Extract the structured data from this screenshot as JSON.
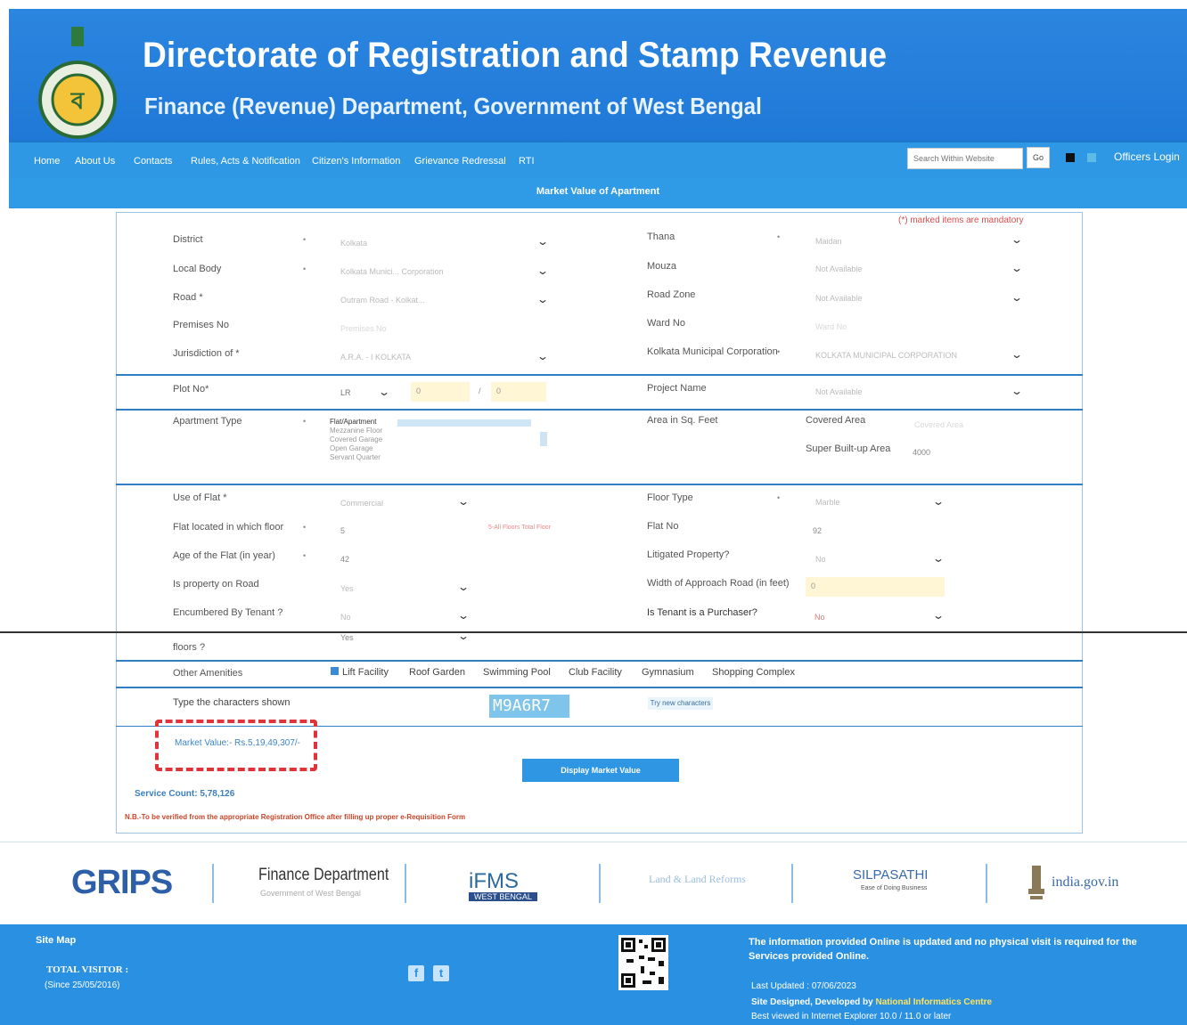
{
  "header": {
    "title": "Directorate of Registration and Stamp Revenue",
    "subtitle": "Finance (Revenue) Department, Government of West Bengal"
  },
  "nav": {
    "items": [
      "Home",
      "About Us",
      "Contacts",
      "Rules, Acts & Notification",
      "Citizen's Information",
      "Grievance Redressal",
      "RTI"
    ],
    "search_placeholder": "Search Within Website",
    "go_label": "Go",
    "officers_login": "Officers Login"
  },
  "section_title": "Market Value of Apartment",
  "mandatory_note": "(*) marked items are mandatory",
  "fields": {
    "district": {
      "label": "District",
      "value": "Kolkata"
    },
    "local_body": {
      "label": "Local Body",
      "value": "Kolkata Munici... Corporation"
    },
    "road": {
      "label": "Road *",
      "value": "Outram Road - Kolkat..."
    },
    "premises_no": {
      "label": "Premises No",
      "value": "Premises No"
    },
    "jurisdiction": {
      "label": "Jurisdiction of *",
      "value": "A.R.A. - I KOLKATA"
    },
    "thana": {
      "label": "Thana",
      "value": "Maidan"
    },
    "mouza": {
      "label": "Mouza",
      "value": "Not Available"
    },
    "road_zone": {
      "label": "Road Zone",
      "value": "Not Available"
    },
    "ward_no": {
      "label": "Ward No",
      "value": "Ward No"
    },
    "kmc": {
      "label": "Kolkata Municipal Corporation",
      "value": "KOLKATA MUNICIPAL CORPORATION"
    },
    "plot_no": {
      "label": "Plot No*",
      "type": "LR",
      "value1": "0",
      "value2": "0"
    },
    "project_name": {
      "label": "Project Name",
      "value": "Not Available"
    },
    "apartment_type": {
      "label": "Apartment Type",
      "options": [
        "Flat/Apartment",
        "Mezzanine Floor",
        "Covered Garage",
        "Open Garage",
        "Servant Quarter"
      ]
    },
    "area": {
      "label": "Area in Sq. Feet",
      "covered_label": "Covered Area",
      "covered_placeholder": "Covered Area",
      "super_label": "Super Built-up Area",
      "super_value": "4000"
    },
    "use_of_flat": {
      "label": "Use of Flat *",
      "value": "Commercial"
    },
    "floor_type": {
      "label": "Floor Type",
      "value": "Marble"
    },
    "flat_floor": {
      "label": "Flat located in which floor",
      "value": "5",
      "hint": "5-All Floors Total Floor"
    },
    "flat_no": {
      "label": "Flat No",
      "value": "92"
    },
    "age": {
      "label": "Age of the Flat (in year)",
      "value": "42"
    },
    "litigated": {
      "label": "Litigated Property?",
      "value": "No"
    },
    "on_road": {
      "label": "Is property on Road",
      "value": "Yes"
    },
    "approach_width": {
      "label": "Width of Approach Road (in feet)",
      "value": "0"
    },
    "encumbered": {
      "label": "Encumbered By Tenant ?",
      "value": "No"
    },
    "tenant_purchaser": {
      "label": "Is Tenant is a Purchaser?",
      "value": "No"
    },
    "floors_q": {
      "label": "floors ?",
      "value": "Yes"
    }
  },
  "amenities": {
    "label": "Other Amenities",
    "items": [
      "Lift Facility",
      "Roof Garden",
      "Swimming Pool",
      "Club Facility",
      "Gymnasium",
      "Shopping Complex"
    ]
  },
  "captcha": {
    "label": "Type the characters shown",
    "code": "M9A6R7",
    "try_new": "Try new characters"
  },
  "market_value": "Market Value:- Rs.5,19,49,307/-",
  "display_button": "Display Market Value",
  "service_count": "Service Count: 5,78,126",
  "nb_note": "N.B.-To be verified from the appropriate Registration Office after filling up proper e-Requisition Form",
  "partners": {
    "grips": "GRIPS",
    "finance": "Finance Department",
    "finance_sub": "Government of West Bengal",
    "ifms": "iFMS",
    "ifms_sub": "WEST BENGAL",
    "land": "Land & Land Reforms",
    "silpasathi": "SILPASATHI",
    "silpasathi_sub": "Ease of Doing Business",
    "indiagov": "india.gov.in"
  },
  "footer": {
    "site_map": "Site Map",
    "total_visitor": "TOTAL VISITOR :",
    "since": "(Since 25/05/2016)",
    "info": "The information provided Online is updated and no physical visit is required for the Services provided Online.",
    "last_updated": "Last Updated : 07/06/2023",
    "designed_prefix": "Site Designed, Developed by",
    "nic": "National Informatics Centre",
    "best_viewed": "Best viewed in Internet Explorer 10.0 / 11.0 or later"
  }
}
